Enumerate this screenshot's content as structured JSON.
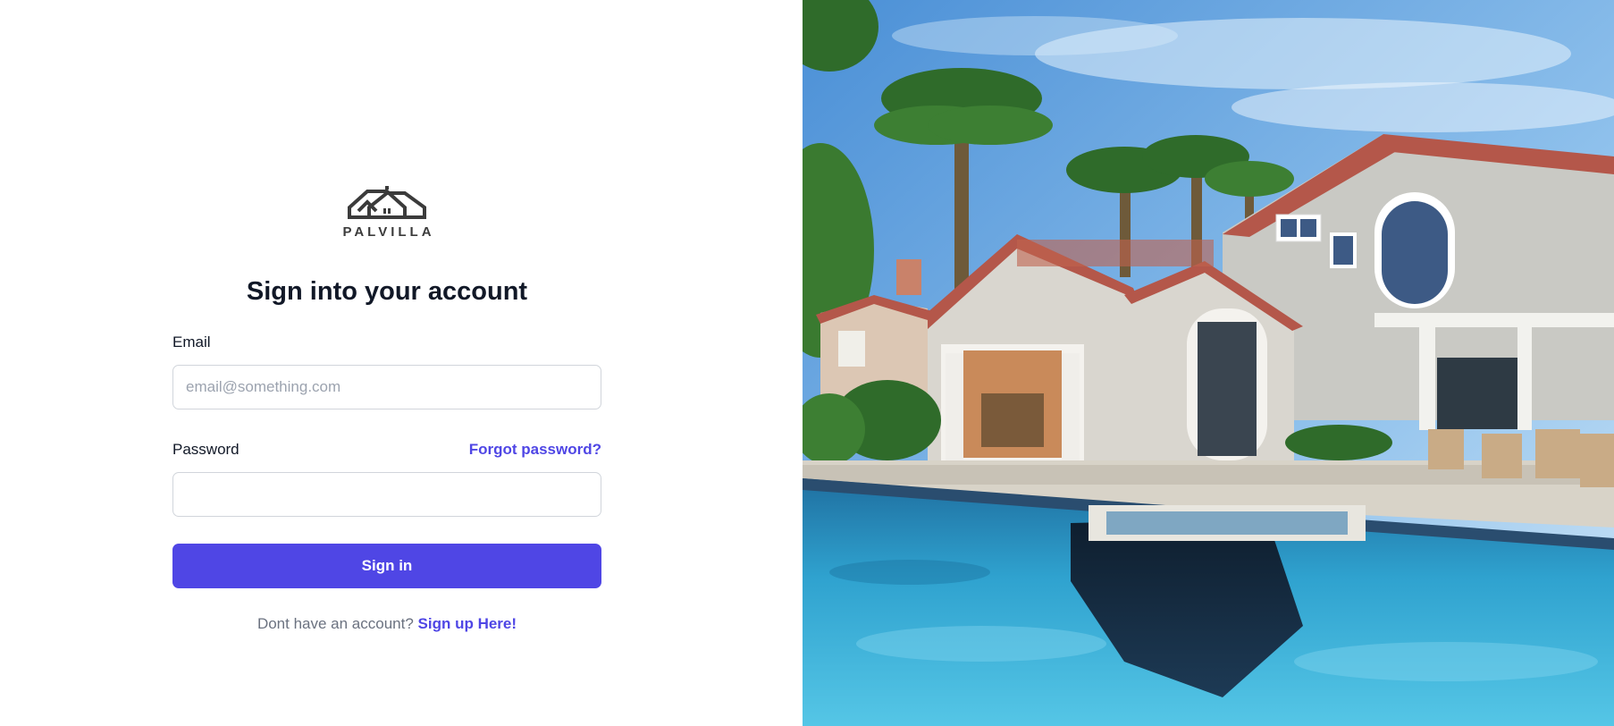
{
  "brand": {
    "name": "PALVILLA",
    "logo_icon": "house-roof-logo-icon",
    "accent_color": "#4f46e5"
  },
  "form": {
    "title": "Sign into your account",
    "email_label": "Email",
    "email_placeholder": "email@something.com",
    "email_value": "",
    "password_label": "Password",
    "password_value": "",
    "forgot_password": "Forgot password?",
    "submit_label": "Sign in",
    "signup_prompt": "Dont have an account?",
    "signup_link": "Sign up Here!"
  }
}
